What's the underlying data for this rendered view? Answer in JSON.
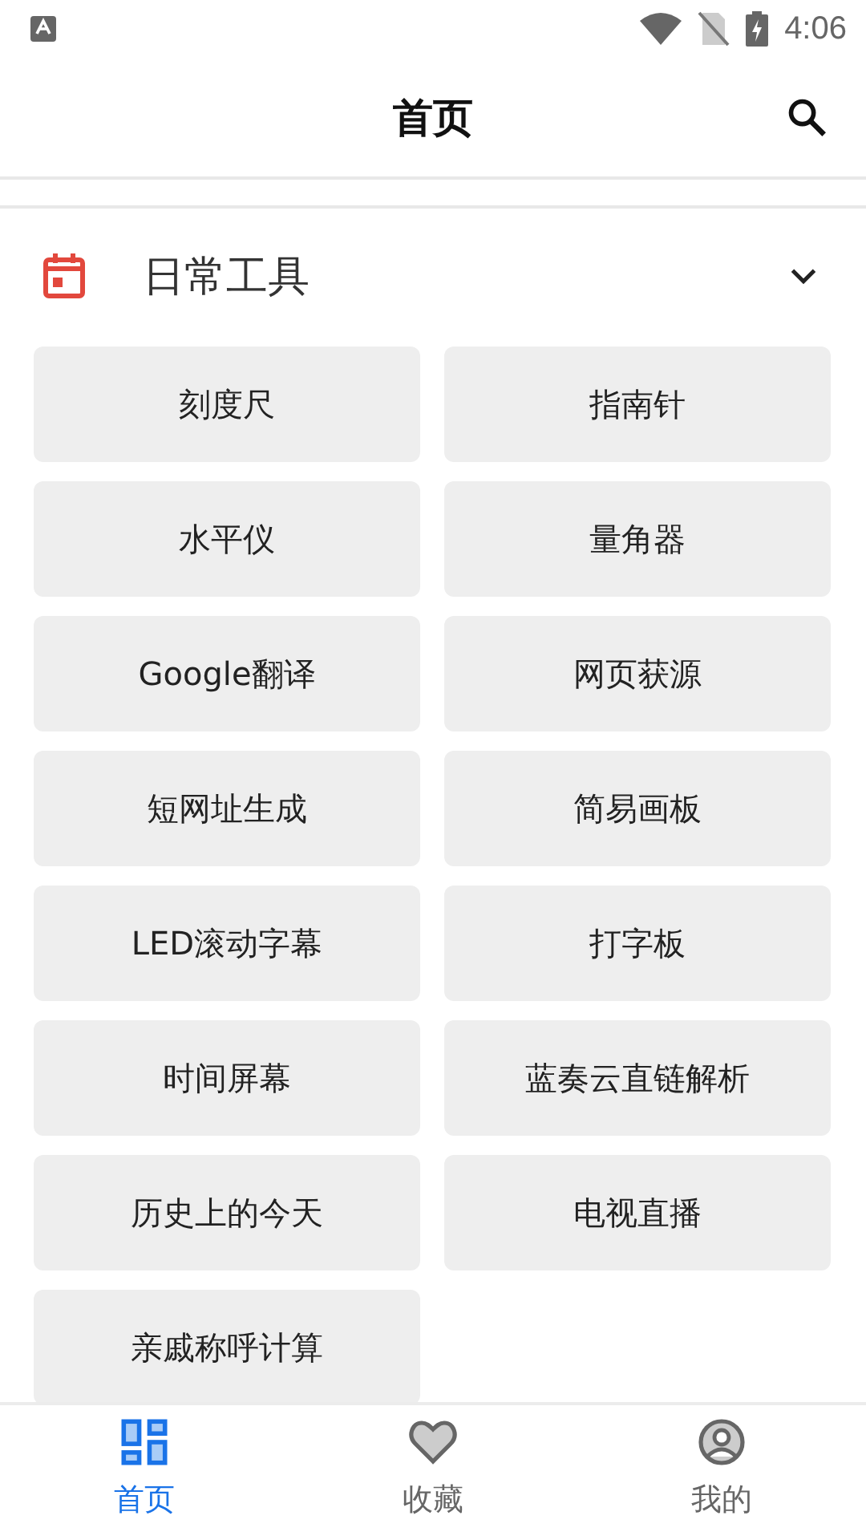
{
  "status_bar": {
    "time": "4:06"
  },
  "header": {
    "title": "首页"
  },
  "section": {
    "title": "日常工具",
    "expanded": true,
    "tools": [
      {
        "label": "刻度尺"
      },
      {
        "label": "指南针"
      },
      {
        "label": "水平仪"
      },
      {
        "label": "量角器"
      },
      {
        "label": "Google翻译"
      },
      {
        "label": "网页获源"
      },
      {
        "label": "短网址生成"
      },
      {
        "label": "简易画板"
      },
      {
        "label": "LED滚动字幕"
      },
      {
        "label": "打字板"
      },
      {
        "label": "时间屏幕"
      },
      {
        "label": "蓝奏云直链解析"
      },
      {
        "label": "历史上的今天"
      },
      {
        "label": "电视直播"
      },
      {
        "label": "亲戚称呼计算"
      }
    ]
  },
  "bottom_nav": [
    {
      "label": "首页",
      "selected": true
    },
    {
      "label": "收藏",
      "selected": false
    },
    {
      "label": "我的",
      "selected": false
    }
  ]
}
